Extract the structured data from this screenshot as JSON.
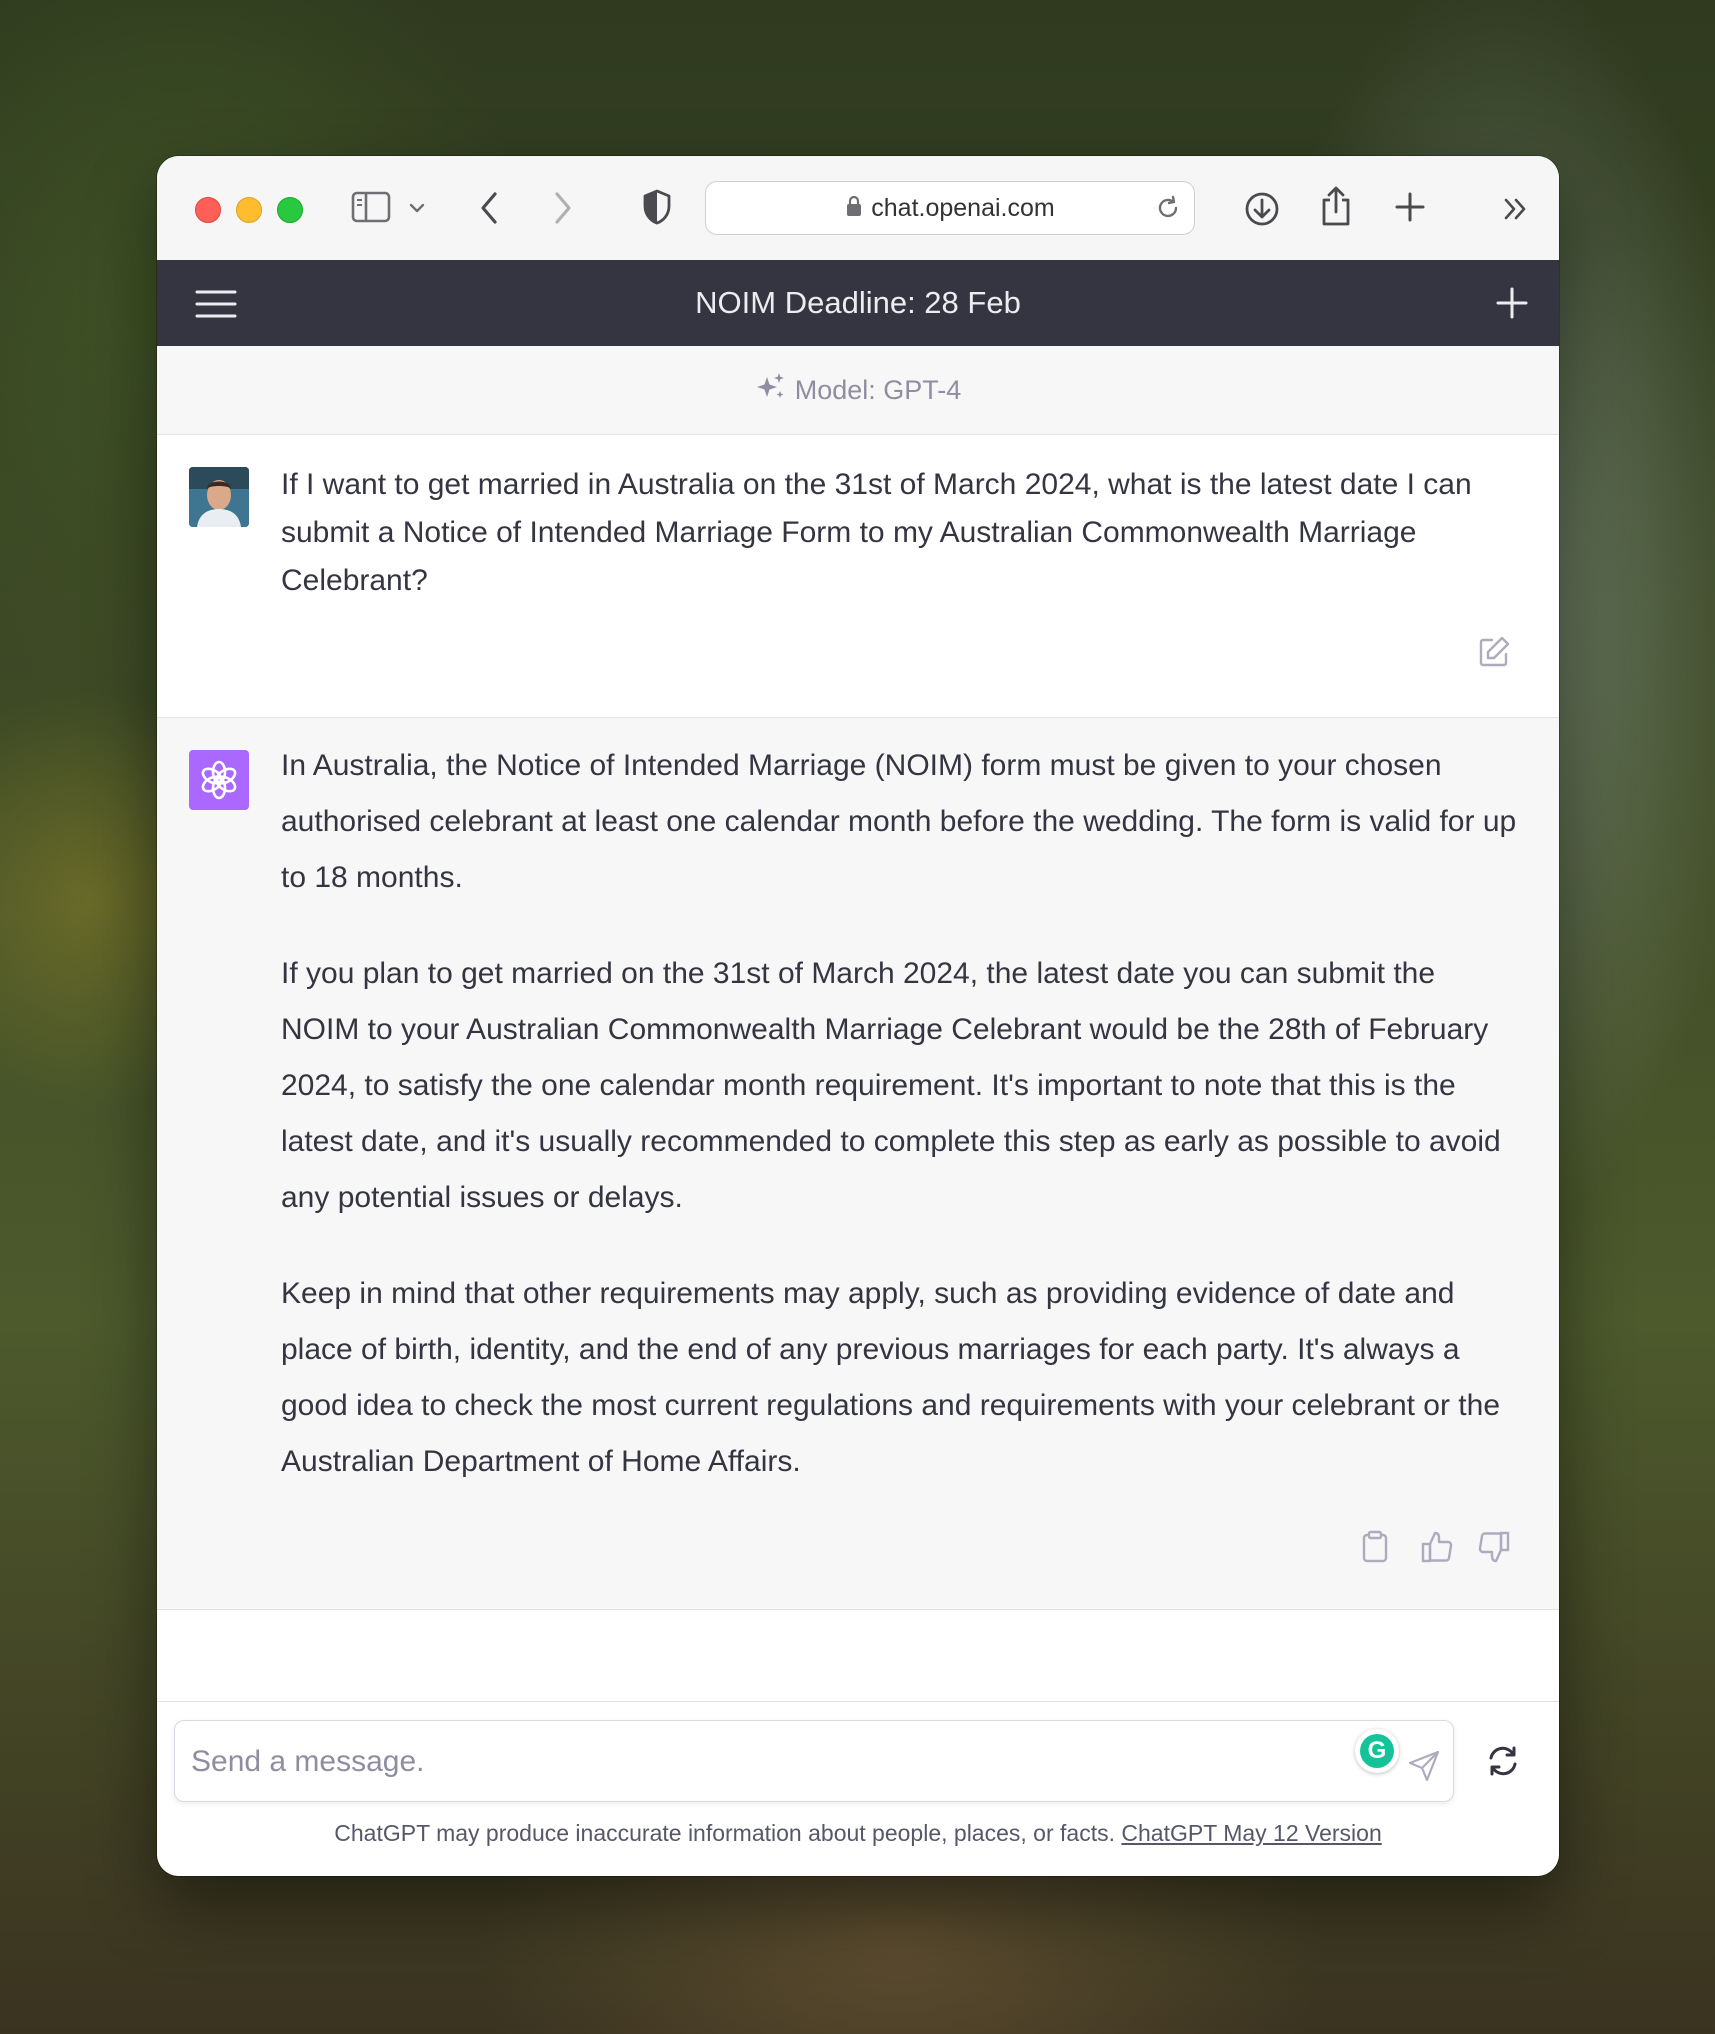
{
  "browser": {
    "url": "chat.openai.com"
  },
  "header": {
    "title": "NOIM Deadline: 28 Feb"
  },
  "model_bar": {
    "label": "Model: GPT-4"
  },
  "conversation": {
    "user_message": "If I want to get married in Australia on the 31st of March 2024, what is the latest date I can submit a Notice of Intended Marriage Form to my Australian Commonwealth Marriage Celebrant?",
    "assistant_paragraphs": [
      "In Australia, the Notice of Intended Marriage (NOIM) form must be given to your chosen authorised celebrant at least one calendar month before the wedding. The form is valid for up to 18 months.",
      "If you plan to get married on the 31st of March 2024, the latest date you can submit the NOIM to your Australian Commonwealth Marriage Celebrant would be the 28th of February 2024, to satisfy the one calendar month requirement. It's important to note that this is the latest date, and it's usually recommended to complete this step as early as possible to avoid any potential issues or delays.",
      "Keep in mind that other requirements may apply, such as providing evidence of date and place of birth, identity, and the end of any previous marriages for each party. It's always a good idea to check the most current regulations and requirements with your celebrant or the Australian Department of Home Affairs."
    ]
  },
  "composer": {
    "placeholder": "Send a message.",
    "grammarly_letter": "G"
  },
  "footer": {
    "disclaimer": "ChatGPT may produce inaccurate information about people, places, or facts.",
    "version_link": "ChatGPT May 12 Version"
  },
  "colors": {
    "header_bg": "#343541",
    "assistant_avatar": "#ab68ff",
    "grammarly": "#15c39a"
  },
  "icons": [
    "sidebar-icon",
    "chevron-down-icon",
    "back-icon",
    "forward-icon",
    "shield-icon",
    "lock-icon",
    "reload-icon",
    "download-icon",
    "share-icon",
    "new-tab-icon",
    "more-icon",
    "hamburger-icon",
    "plus-icon",
    "sparkle-icon",
    "edit-icon",
    "openai-logo-icon",
    "copy-icon",
    "thumbs-up-icon",
    "thumbs-down-icon",
    "send-icon",
    "regenerate-icon"
  ]
}
